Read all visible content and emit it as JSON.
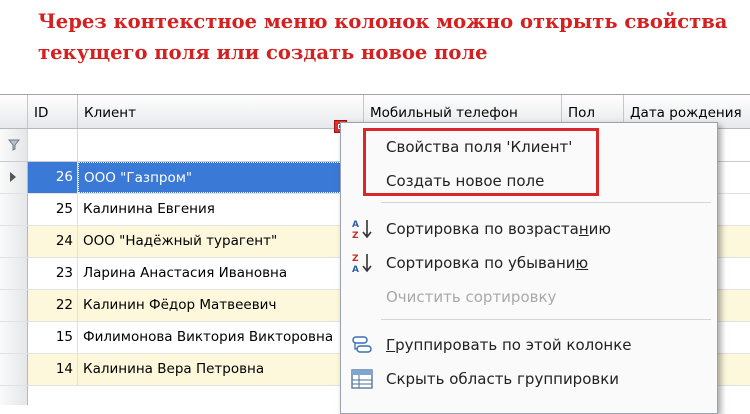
{
  "caption": {
    "line1": "Через контекстное меню колонок можно открыть свойства",
    "line2": "текущего поля или создать новое поле"
  },
  "grid": {
    "columns": [
      "ID",
      "Клиент",
      "Мобильный телефон",
      "Пол",
      "Дата рождения"
    ],
    "rows": [
      {
        "id": "26",
        "client": "ООО \"Газпром\""
      },
      {
        "id": "25",
        "client": "Калинина Евгения"
      },
      {
        "id": "24",
        "client": "ООО \"Надёжный турагент\""
      },
      {
        "id": "23",
        "client": "Ларина Анастасия Ивановна"
      },
      {
        "id": "22",
        "client": "Калинин Фёдор Матвеевич"
      },
      {
        "id": "15",
        "client": "Филимонова Виктория Викторовна"
      },
      {
        "id": "14",
        "client": "Калинина Вера Петровна"
      }
    ]
  },
  "context_menu": {
    "field_properties": "Свойства поля 'Клиент'",
    "create_field": "Создать новое поле",
    "sort_asc": {
      "before": "Сортировка по возраста",
      "key": "н",
      "after": "ию"
    },
    "sort_desc": {
      "before": "Сортировка по убывани",
      "key": "ю",
      "after": ""
    },
    "clear_sort": "Очистить сортировку",
    "group_by": {
      "key": "Г",
      "after": "руппировать по этой колонке"
    },
    "hide_group_area": "Скрыть область группировки"
  },
  "colors": {
    "caption": "#d42020",
    "selection": "#3b79d6",
    "highlight_box": "#d8282a",
    "odd_row": "#fdf8dc"
  },
  "icons": [
    "filter-icon",
    "row-indicator-icon",
    "sort-ascending-icon",
    "sort-descending-icon",
    "group-by-icon",
    "group-area-icon"
  ]
}
